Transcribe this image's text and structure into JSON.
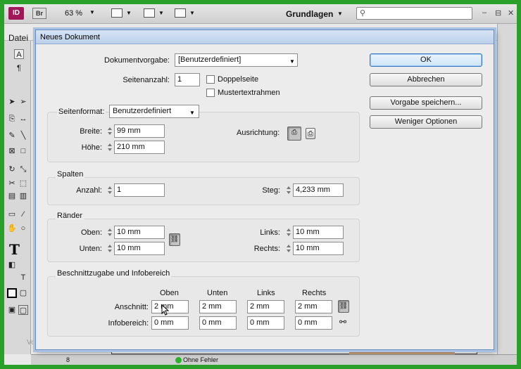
{
  "app": {
    "logo": "ID",
    "bridge": "Br",
    "zoom": "63 %",
    "workspace": "Grundlagen",
    "search_placeholder": "",
    "window_controls": [
      "–",
      "⊟",
      "✕"
    ]
  },
  "menu": {
    "first": "Datei"
  },
  "status": {
    "page": "8",
    "preflight": "Ohne Fehler",
    "panel_label": "Vorlagen"
  },
  "dialog": {
    "title": "Neues Dokument",
    "preset_label": "Dokumentvorgabe:",
    "preset_value": "[Benutzerdefiniert]",
    "pages_label": "Seitenanzahl:",
    "pages_value": "1",
    "facing_pages": {
      "label": "Doppelseite",
      "checked": false
    },
    "master_frame": {
      "label": "Mustertextrahmen",
      "checked": false
    },
    "buttons": {
      "ok": "OK",
      "cancel": "Abbrechen",
      "save_preset": "Vorgabe speichern...",
      "fewer_options": "Weniger Optionen"
    },
    "page_size": {
      "label": "Seitenformat:",
      "value": "Benutzerdefiniert",
      "width_label": "Breite:",
      "width_value": "99 mm",
      "height_label": "Höhe:",
      "height_value": "210 mm",
      "orientation_label": "Ausrichtung:",
      "orientation": "portrait"
    },
    "columns": {
      "title": "Spalten",
      "count_label": "Anzahl:",
      "count_value": "1",
      "gutter_label": "Steg:",
      "gutter_value": "4,233 mm"
    },
    "margins": {
      "title": "Ränder",
      "top_label": "Oben:",
      "top_value": "10 mm",
      "bottom_label": "Unten:",
      "bottom_value": "10 mm",
      "left_label": "Links:",
      "left_value": "10 mm",
      "right_label": "Rechts:",
      "right_value": "10 mm",
      "linked": true
    },
    "bleed": {
      "title": "Beschnittzugabe und Infobereich",
      "columns": [
        "Oben",
        "Unten",
        "Links",
        "Rechts"
      ],
      "bleed_label": "Anschnitt:",
      "bleed_values": [
        "2 mm",
        "2 mm",
        "2 mm",
        "2 mm"
      ],
      "slug_label": "Infobereich:",
      "slug_values": [
        "0 mm",
        "0 mm",
        "0 mm",
        "0 mm"
      ]
    }
  }
}
